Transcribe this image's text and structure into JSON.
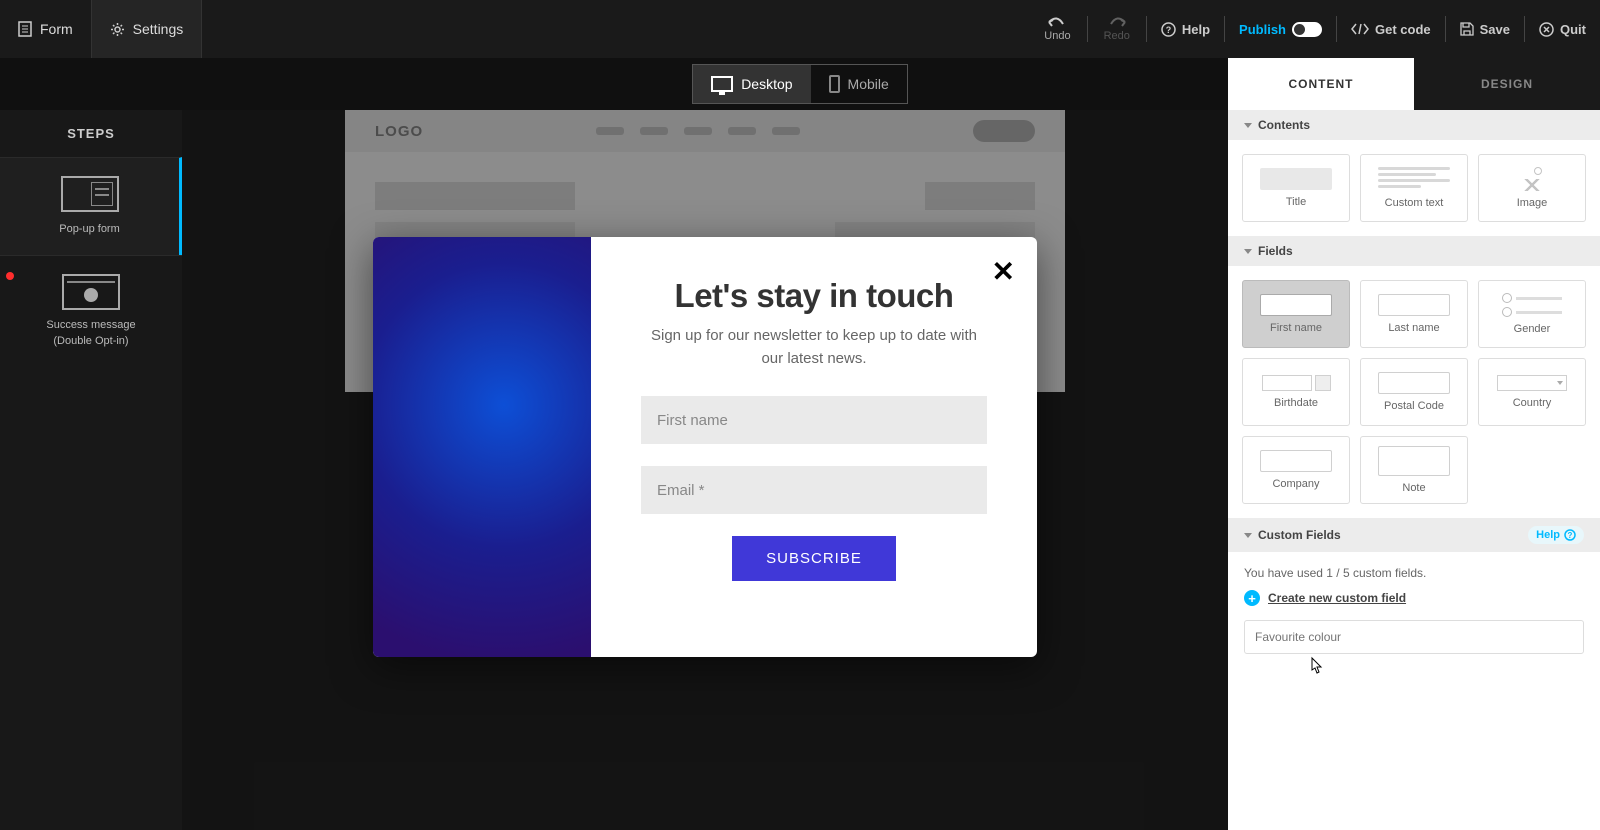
{
  "topbar": {
    "form": "Form",
    "settings": "Settings",
    "undo": "Undo",
    "redo": "Redo",
    "help": "Help",
    "publish": "Publish",
    "getcode": "Get code",
    "save": "Save",
    "quit": "Quit"
  },
  "devices": {
    "desktop": "Desktop",
    "mobile": "Mobile"
  },
  "steps": {
    "title": "STEPS",
    "step1": "Pop-up form",
    "step2a": "Success message",
    "step2b": "(Double Opt-in)"
  },
  "fakepage": {
    "logo": "LOGO"
  },
  "popup": {
    "title": "Let's stay in touch",
    "subtitle": "Sign up for our newsletter to keep up to date with our latest news.",
    "field1": "First name",
    "field2": "Email *",
    "button": "SUBSCRIBE"
  },
  "rightpanel": {
    "tab_content": "CONTENT",
    "tab_design": "DESIGN",
    "sec_contents": "Contents",
    "card_title": "Title",
    "card_customtext": "Custom text",
    "card_image": "Image",
    "sec_fields": "Fields",
    "f_firstname": "First name",
    "f_lastname": "Last name",
    "f_gender": "Gender",
    "f_birthdate": "Birthdate",
    "f_postal": "Postal Code",
    "f_country": "Country",
    "f_company": "Company",
    "f_note": "Note",
    "sec_custom": "Custom Fields",
    "help": "Help",
    "usage": "You have used 1 / 5 custom fields.",
    "create": "Create new custom field",
    "custom_placeholder": "Favourite colour"
  }
}
